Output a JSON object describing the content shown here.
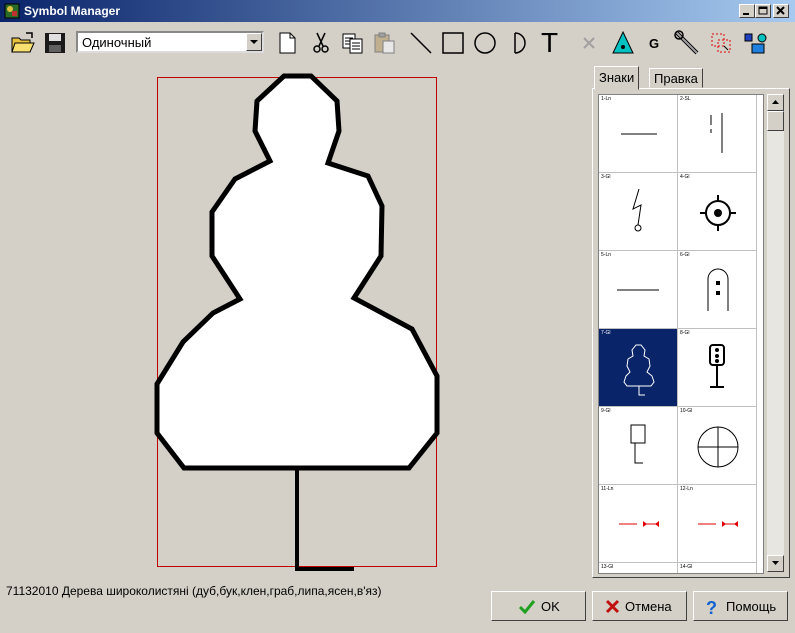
{
  "window": {
    "title": "Symbol Manager"
  },
  "toolbar": {
    "mode_value": "Одиночный",
    "text_tool_glyph": "T",
    "g_tool_glyph": "G"
  },
  "tabs": [
    {
      "label": "Знаки"
    },
    {
      "label": "Правка"
    }
  ],
  "symbols": [
    {
      "label": "1-Ln"
    },
    {
      "label": "2-SL"
    },
    {
      "label": "3-Gl"
    },
    {
      "label": "4-Gl"
    },
    {
      "label": "5-Ln"
    },
    {
      "label": "6-Gl"
    },
    {
      "label": "7-Gl"
    },
    {
      "label": "8-Gl"
    },
    {
      "label": "9-Gl"
    },
    {
      "label": "10-Gl"
    },
    {
      "label": "11-Ln"
    },
    {
      "label": "12-Ln"
    },
    {
      "label": "13-Gl"
    },
    {
      "label": "14-Gl"
    }
  ],
  "status": {
    "text": "71132010 Дерева широколистяні (дуб,бук,клен,граб,липа,ясен,в'яз)"
  },
  "buttons": {
    "ok": "OK",
    "cancel": "Отмена",
    "help": "Помощь"
  },
  "colors": {
    "titlebar_start": "#0a246a",
    "titlebar_end": "#a6caf0",
    "selection": "#0a246a",
    "frame": "#c00000"
  }
}
